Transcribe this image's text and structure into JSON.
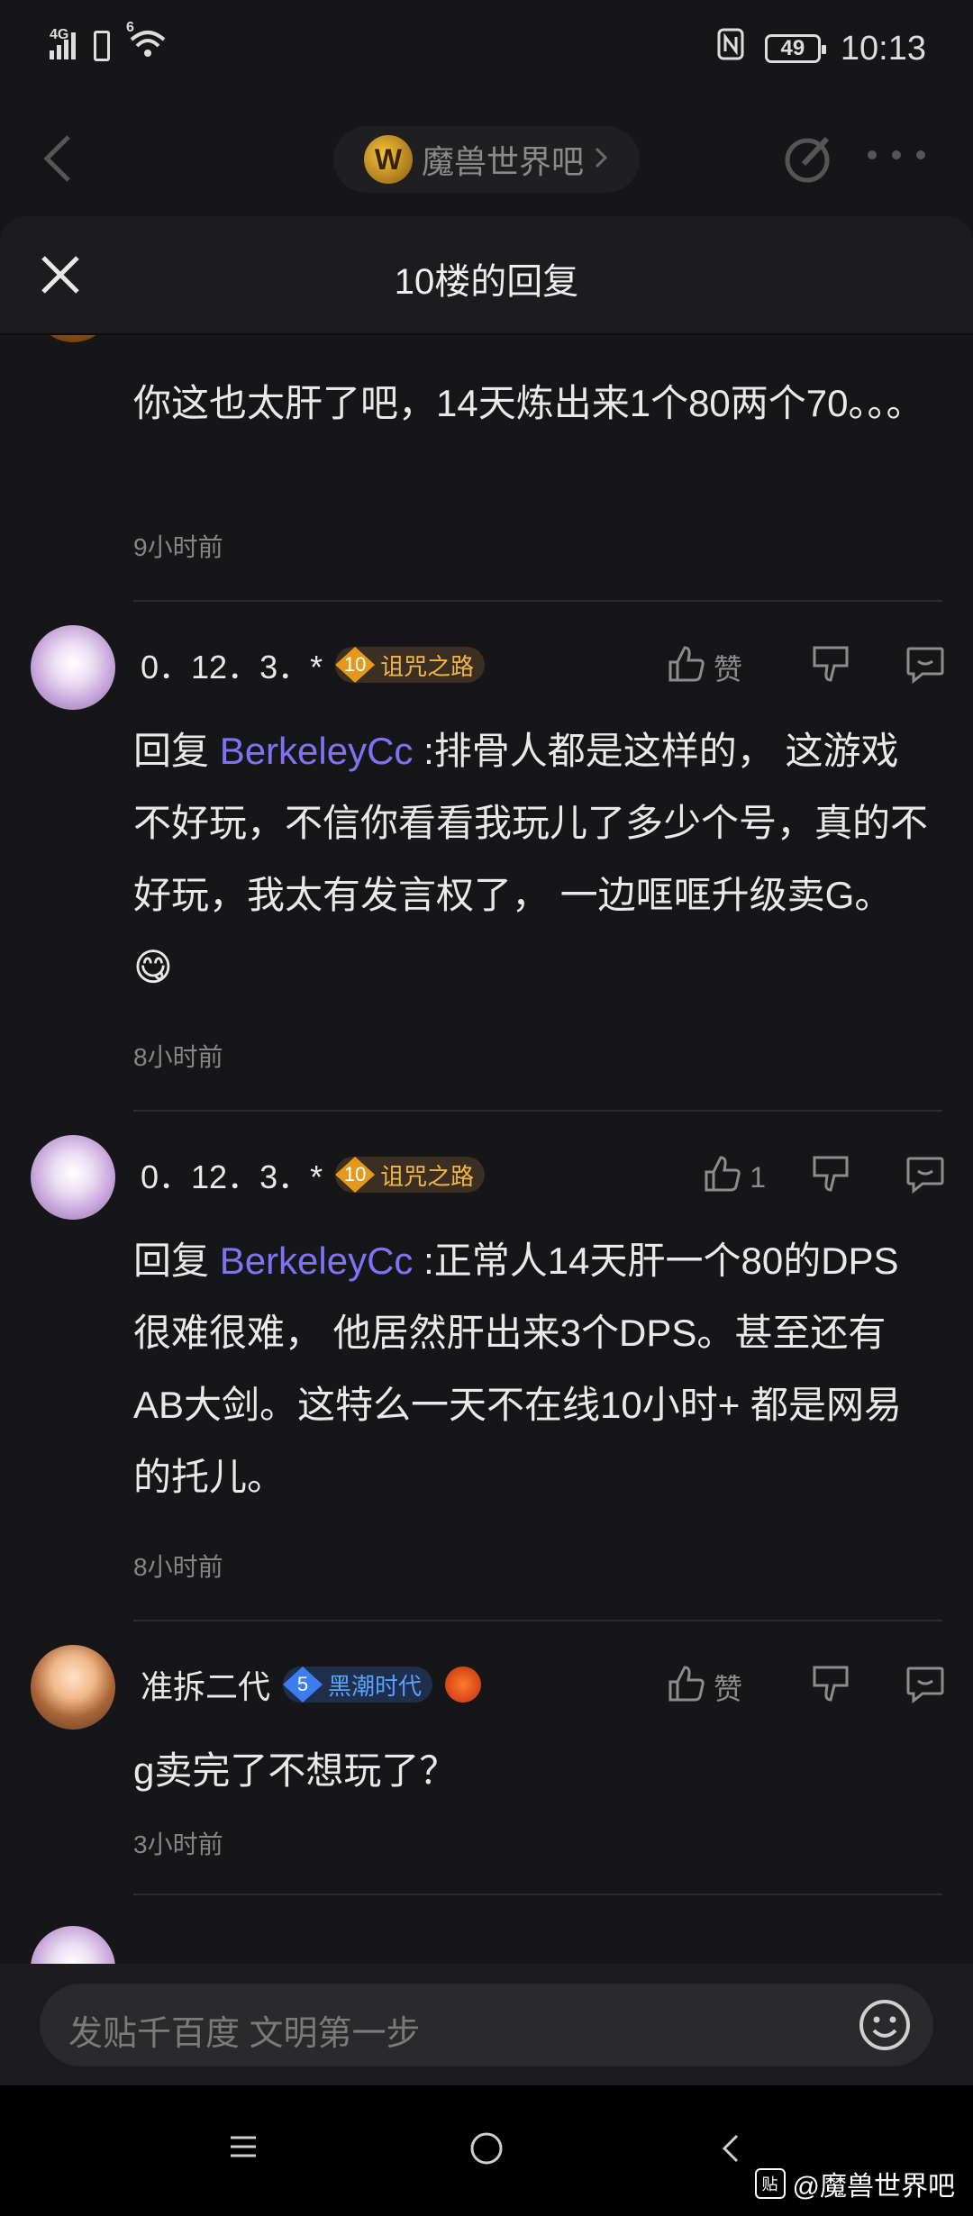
{
  "status_bar": {
    "network": "4G",
    "sim2": "6",
    "battery": "49",
    "time": "10:13"
  },
  "top_nav": {
    "forum_name": "魔兽世界吧",
    "forum_logo_letter": "W"
  },
  "sheet": {
    "title": "10楼的回复"
  },
  "replies": [
    {
      "text": "你这也太肝了吧，14天炼出来1个80两个70。。。",
      "time": "9小时前"
    },
    {
      "username": "0．12．3．*",
      "level": "10",
      "badge": "诅咒之路",
      "like_label": "赞",
      "prefix": "回复",
      "mention": "BerkeleyCc",
      "text": " :排骨人都是这样的， 这游戏不好玩，不信你看看我玩儿了多少个号，真的不好玩，我太有发言权了， 一边哐哐升级卖G。",
      "emoji": "😋",
      "time": "8小时前"
    },
    {
      "username": "0．12．3．*",
      "level": "10",
      "badge": "诅咒之路",
      "like_label": "1",
      "prefix": "回复",
      "mention": "BerkeleyCc",
      "text": " :正常人14天肝一个80的DPS 很难很难， 他居然肝出来3个DPS。甚至还有AB大剑。这特么一天不在线10小时+ 都是网易的托儿。",
      "time": "8小时前"
    },
    {
      "username": "准拆二代",
      "level": "5",
      "badge": "黑潮时代",
      "like_label": "赞",
      "text": "g卖完了不想玩了？",
      "time": "3小时前"
    }
  ],
  "input_bar": {
    "placeholder": "发贴千百度 文明第一步"
  },
  "watermark": {
    "box": "贴",
    "text": "@魔兽世界吧"
  },
  "colors": {
    "background": "#161618",
    "mention": "#7f72f5",
    "badge_gold": "#f2b548",
    "badge_blue": "#5aa0ff"
  }
}
